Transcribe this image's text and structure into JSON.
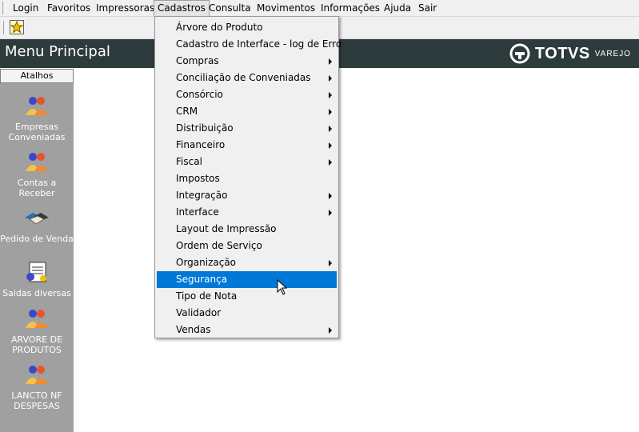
{
  "menubar": {
    "items": [
      "Login",
      "Favoritos",
      "Impressoras",
      "Cadastros",
      "Consulta",
      "Movimentos",
      "Informações",
      "Ajuda",
      "Sair"
    ]
  },
  "header": {
    "title": "Menu Principal",
    "brand": "TOTVS",
    "brand_sub": "VAREJO"
  },
  "sidebar": {
    "tab_label": "Atalhos",
    "shortcuts": [
      {
        "label": "Empresas Conveniadas",
        "icon": "people-icon"
      },
      {
        "label": "Contas a Receber",
        "icon": "people-icon"
      },
      {
        "label": "Pedido de Venda",
        "icon": "handshake-icon"
      },
      {
        "label": "Saidas diversas",
        "icon": "document-icon"
      },
      {
        "label": "ARVORE DE PRODUTOS",
        "icon": "people-icon"
      },
      {
        "label": "LANCTO NF DESPESAS",
        "icon": "people-icon"
      }
    ]
  },
  "dropdown": {
    "items": [
      {
        "label": "Árvore do Produto",
        "submenu": false
      },
      {
        "label": "Cadastro de Interface - log de Erro",
        "submenu": false
      },
      {
        "label": "Compras",
        "submenu": true
      },
      {
        "label": "Conciliação de Conveniadas",
        "submenu": true
      },
      {
        "label": "Consórcio",
        "submenu": true
      },
      {
        "label": "CRM",
        "submenu": true
      },
      {
        "label": "Distribuição",
        "submenu": true
      },
      {
        "label": "Financeiro",
        "submenu": true
      },
      {
        "label": "Fiscal",
        "submenu": true
      },
      {
        "label": "Impostos",
        "submenu": false
      },
      {
        "label": "Integração",
        "submenu": true
      },
      {
        "label": "Interface",
        "submenu": true
      },
      {
        "label": "Layout de Impressão",
        "submenu": false
      },
      {
        "label": "Ordem de Serviço",
        "submenu": false
      },
      {
        "label": "Organização",
        "submenu": true
      },
      {
        "label": "Segurança",
        "submenu": false,
        "highlighted": true
      },
      {
        "label": "Tipo de Nota",
        "submenu": false
      },
      {
        "label": "Validador",
        "submenu": false
      },
      {
        "label": "Vendas",
        "submenu": true
      }
    ]
  },
  "colors": {
    "header_bg": "#2e3b3c",
    "sidebar_bg": "#a0a0a0",
    "highlight": "#0078d7",
    "menu_bg": "#f0f0f0"
  }
}
